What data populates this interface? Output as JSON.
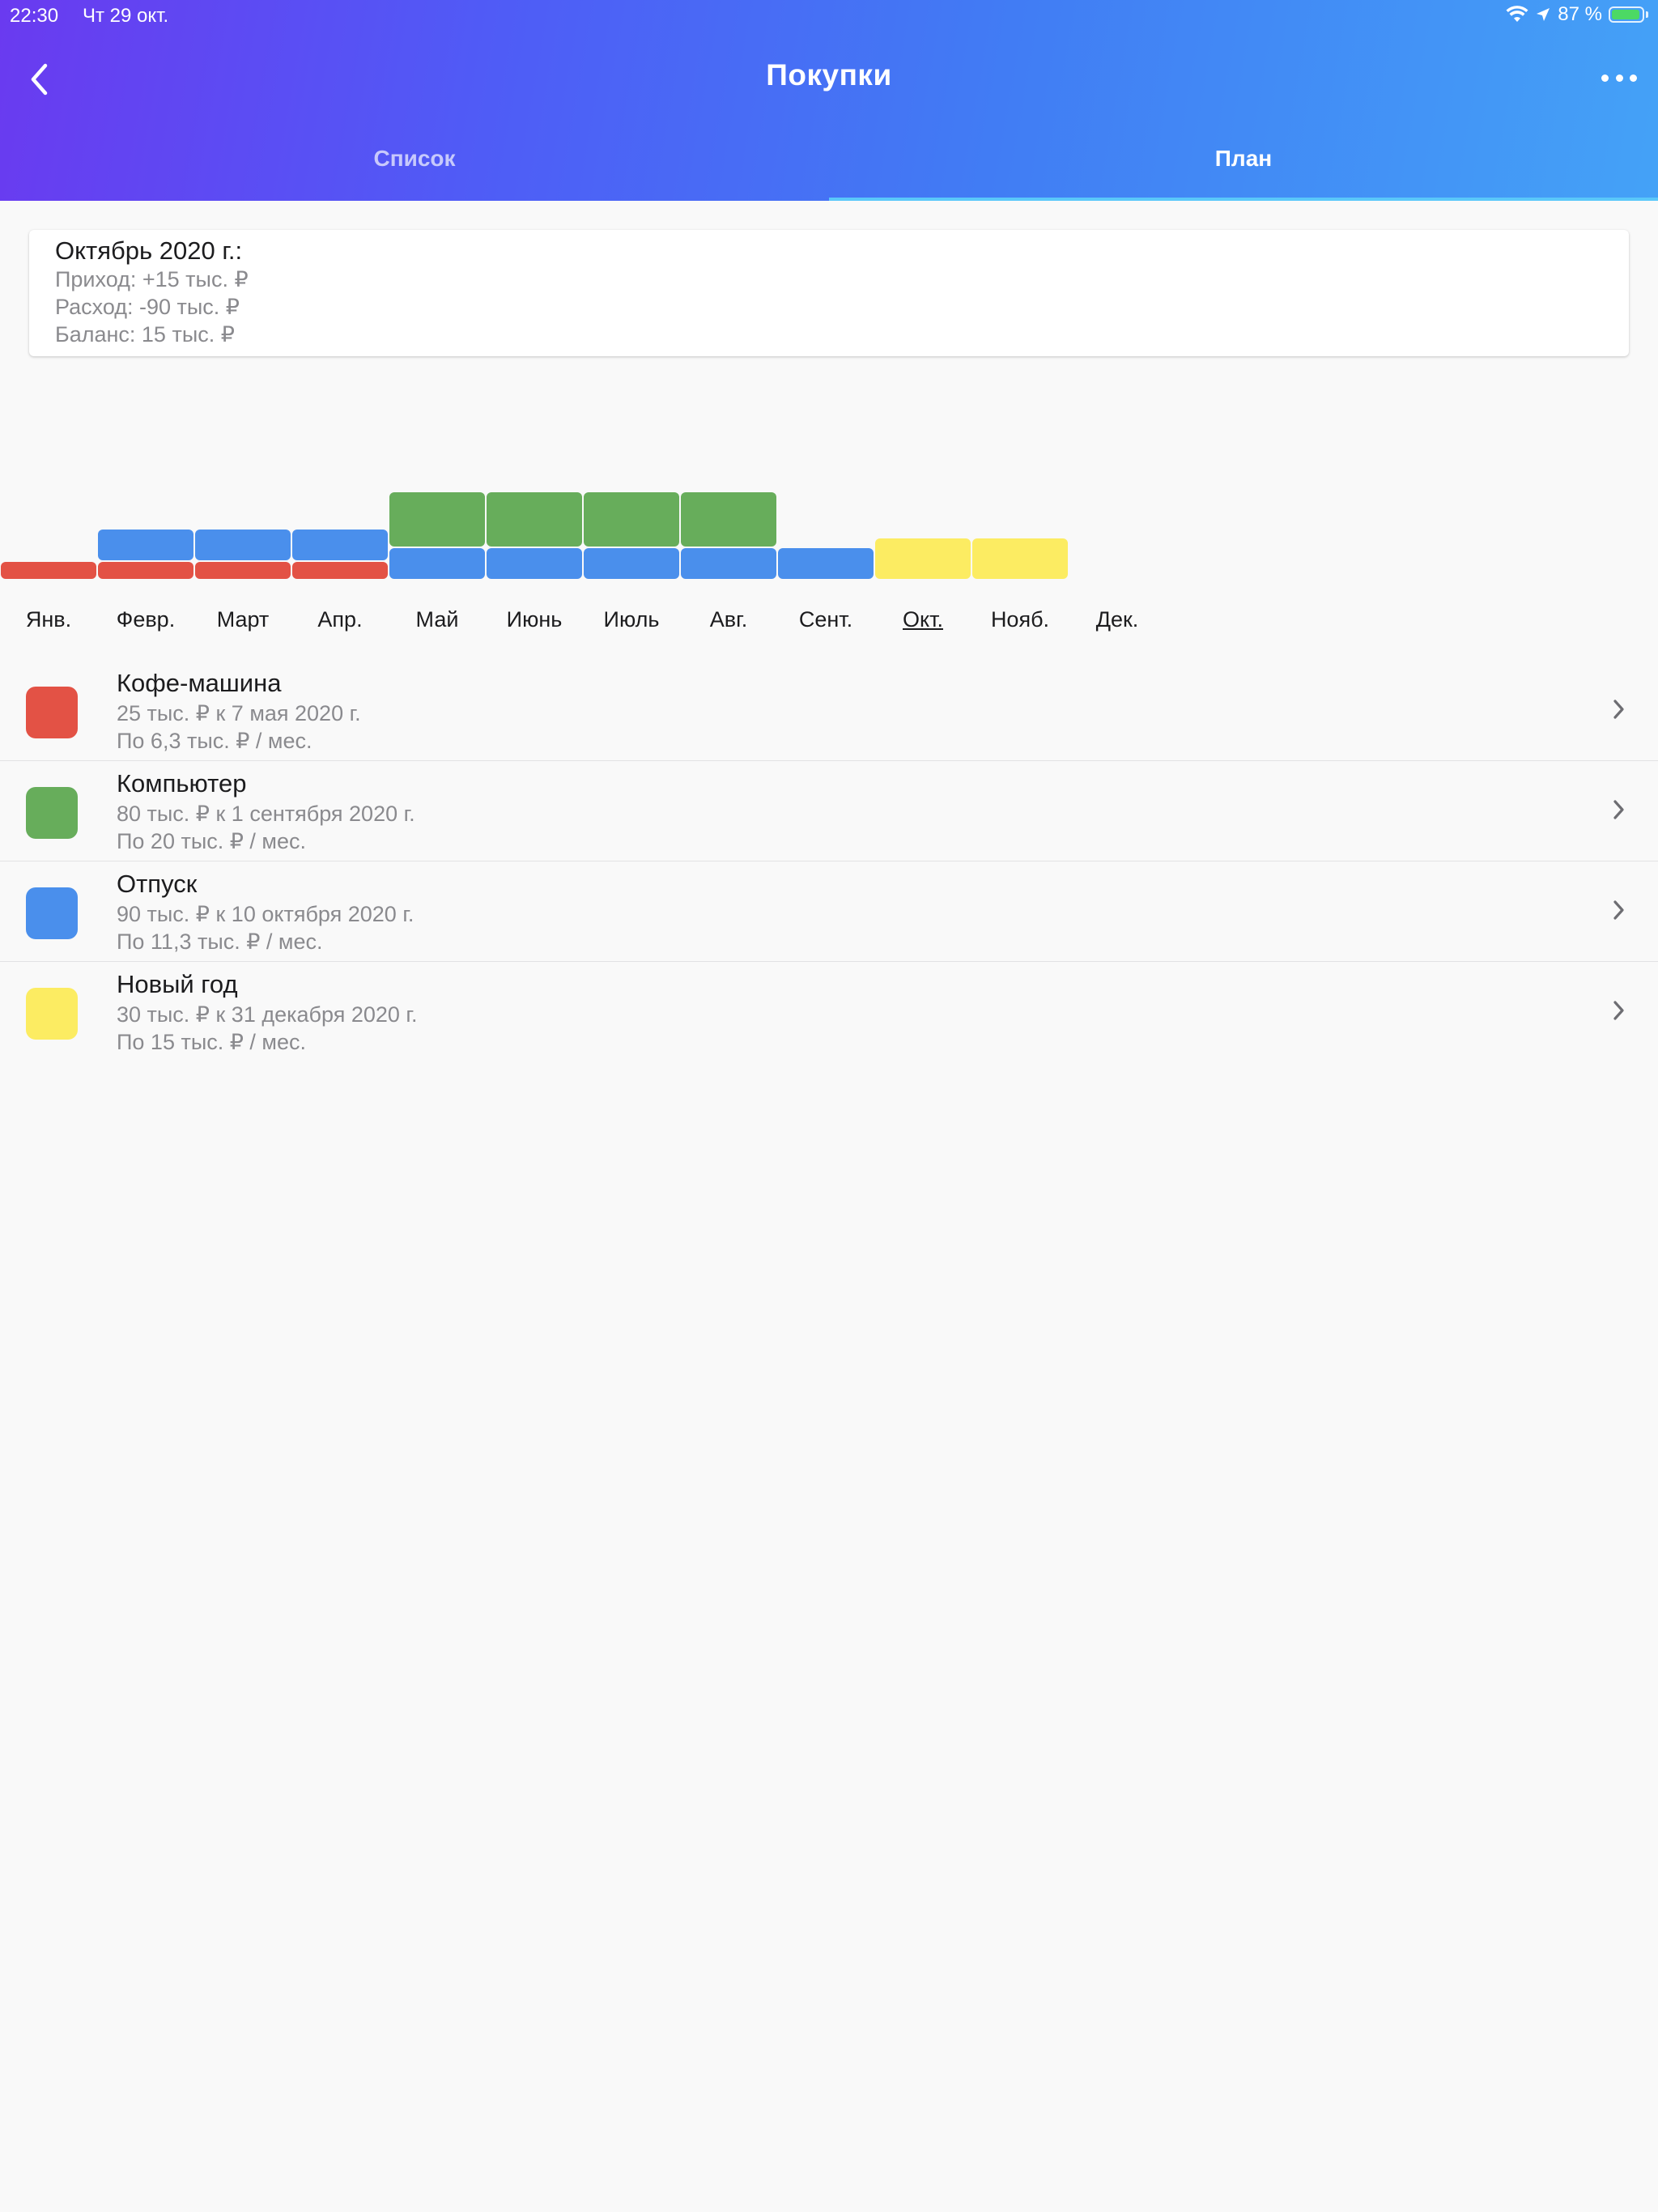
{
  "status_bar": {
    "time": "22:30",
    "date": "Чт 29 окт.",
    "battery": "87 %"
  },
  "header": {
    "title": "Покупки",
    "back_icon": "chevron-left-icon",
    "more_icon": "ellipsis-icon",
    "tabs": [
      {
        "label": "Список",
        "active": false
      },
      {
        "label": "План",
        "active": true
      }
    ]
  },
  "summary": {
    "title": "Октябрь 2020 г.:",
    "income": "Приход: +15 тыс. ₽",
    "expense": "Расход: -90 тыс. ₽",
    "balance": "Баланс: 15 тыс. ₽"
  },
  "chart_data": {
    "type": "bar",
    "categories": [
      "Янв.",
      "Февр.",
      "Март",
      "Апр.",
      "Май",
      "Июнь",
      "Июль",
      "Авг.",
      "Сент.",
      "Окт.",
      "Нояб.",
      "Дек."
    ],
    "current_month": "Окт.",
    "series": [
      {
        "color": "#e35245",
        "values": [
          6.3,
          6.3,
          6.3,
          6.3,
          0,
          0,
          0,
          0,
          0,
          0,
          0,
          0
        ]
      },
      {
        "color": "#4a8fec",
        "values": [
          0,
          11.3,
          11.3,
          11.3,
          11.3,
          11.3,
          11.3,
          11.3,
          11.3,
          0,
          0,
          0
        ]
      },
      {
        "color": "#67ad5b",
        "values": [
          0,
          0,
          0,
          0,
          20,
          20,
          20,
          20,
          0,
          0,
          0,
          0
        ]
      },
      {
        "color": "#fcec62",
        "values": [
          0,
          0,
          0,
          0,
          0,
          0,
          0,
          0,
          0,
          15,
          15,
          0
        ]
      }
    ]
  },
  "goals": [
    {
      "name": "Кофе-машина",
      "target": "25 тыс. ₽ к 7 мая 2020 г.",
      "monthly": "По 6,3 тыс. ₽ / мес.",
      "color": "#e35245"
    },
    {
      "name": "Компьютер",
      "target": "80 тыс. ₽ к 1 сентября 2020 г.",
      "monthly": "По 20 тыс. ₽ / мес.",
      "color": "#67ad5b"
    },
    {
      "name": "Отпуск",
      "target": "90 тыс. ₽ к 10 октября 2020 г.",
      "monthly": "По 11,3 тыс. ₽ / мес.",
      "color": "#4a8fec"
    },
    {
      "name": "Новый год",
      "target": "30 тыс. ₽ к 31 декабря 2020 г.",
      "monthly": "По 15 тыс. ₽ / мес.",
      "color": "#fcec62"
    }
  ]
}
